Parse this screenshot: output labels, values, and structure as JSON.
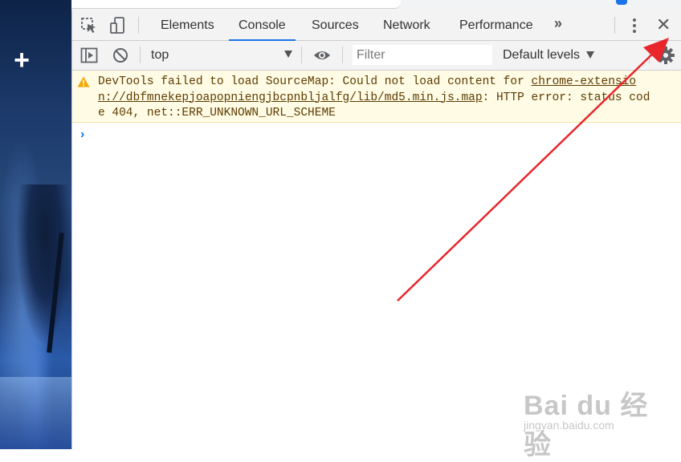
{
  "wallpaper": {
    "add_label": "+"
  },
  "devtools": {
    "tabs": [
      {
        "label": "Elements"
      },
      {
        "label": "Console"
      },
      {
        "label": "Sources"
      },
      {
        "label": "Network"
      },
      {
        "label": "Performance"
      }
    ],
    "overflow_label": "»",
    "close_label": "✕",
    "active_tab": "Console"
  },
  "console_toolbar": {
    "context": "top",
    "filter_placeholder": "Filter",
    "levels": "Default levels"
  },
  "messages": [
    {
      "level": "warning",
      "text_before": "DevTools failed to load SourceMap: Could not load content for ",
      "link": "chrome-extension://dbfmnekepjoapopniengjbcpnbljalfg/lib/md5.min.js.map",
      "text_after": ": HTTP error: status code 404, net::ERR_UNKNOWN_URL_SCHEME"
    }
  ],
  "prompt_symbol": "›",
  "colors": {
    "accent": "#1a73e8",
    "warning_bg": "#fffbe5",
    "warning_text": "#5c3c00",
    "annotation": "#e8262c"
  },
  "watermark": {
    "main": "Bai du 经验",
    "sub": "jingyan.baidu.com"
  }
}
